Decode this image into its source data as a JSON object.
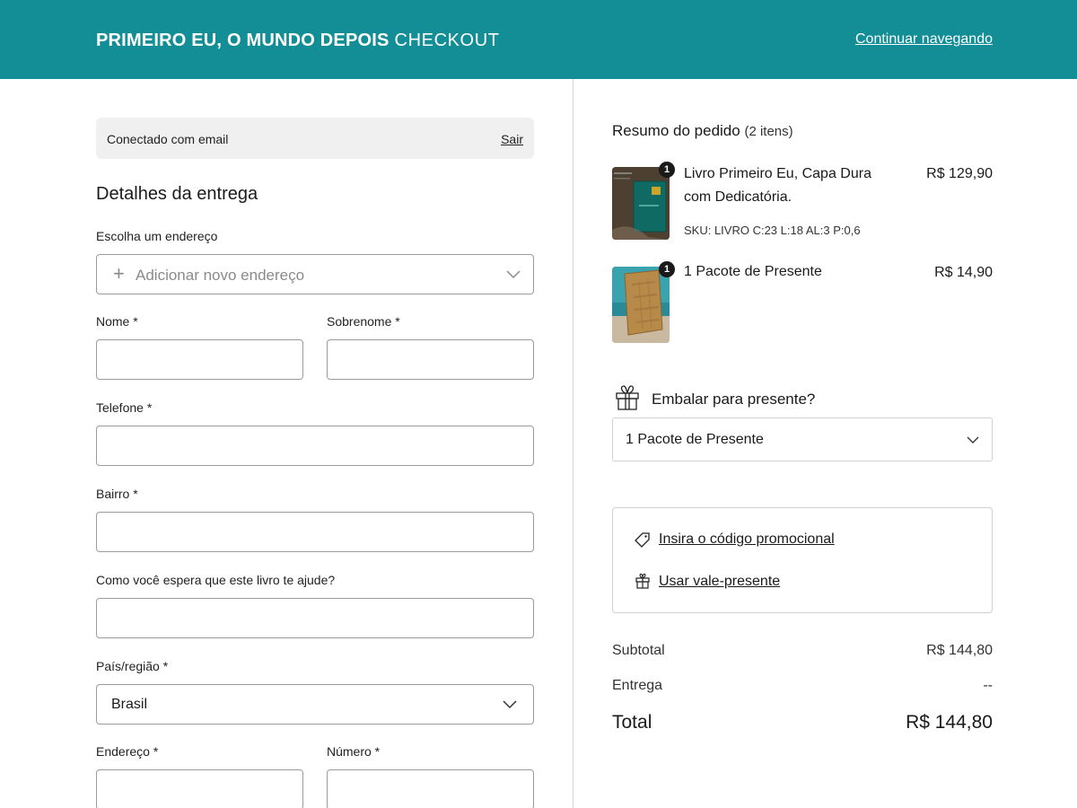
{
  "header": {
    "store_name": "PRIMEIRO EU, O MUNDO DEPOIS",
    "page_label": "CHECKOUT",
    "continue_link": "Continuar navegando",
    "background_color": "#138e96"
  },
  "login": {
    "text": "Conectado com email",
    "logout_link": "Sair"
  },
  "delivery": {
    "title": "Detalhes da entrega",
    "address_label": "Escolha um endereço",
    "address_placeholder": "Adicionar novo endereço",
    "fields": {
      "first_name_label": "Nome *",
      "last_name_label": "Sobrenome *",
      "phone_label": "Telefone *",
      "neighborhood_label": "Bairro *",
      "question_label": "Como você espera que este livro te ajude?",
      "country_label": "País/região *",
      "country_value": "Brasil",
      "address_field_label": "Endereço *",
      "number_label": "Número *"
    }
  },
  "summary": {
    "title": "Resumo do pedido",
    "count": "(2 itens)",
    "items": [
      {
        "name_line1": "Livro Primeiro Eu, Capa Dura",
        "name_line2": "com Dedicatória.",
        "price": "R$ 129,90",
        "sku": "SKU: LIVRO C:23 L:18 AL:3 P:0,6",
        "quantity": "1"
      },
      {
        "name_line1": "1 Pacote de Presente",
        "price": "R$ 14,90",
        "quantity": "1"
      }
    ],
    "gift_label": "Embalar para presente?",
    "gift_select_value": "1 Pacote de Presente",
    "promo_link": "Insira o código promocional",
    "voucher_link": "Usar vale-presente",
    "subtotal_label": "Subtotal",
    "subtotal_value": "R$ 144,80",
    "shipping_label": "Entrega",
    "shipping_value": "--",
    "total_label": "Total",
    "total_value": "R$ 144,80"
  }
}
